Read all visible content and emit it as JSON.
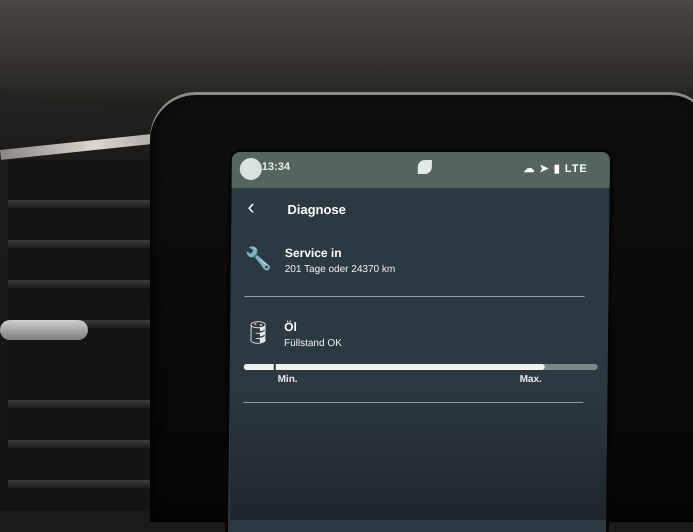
{
  "status_bar": {
    "time": "13:34",
    "indicators": "LTE",
    "icons": [
      "profile-icon",
      "leaf-icon",
      "cloud-icon",
      "location-icon",
      "signal-icon"
    ]
  },
  "header": {
    "back_icon": "chevron-left-icon",
    "title": "Diagnose"
  },
  "service": {
    "icon": "wrench-icon",
    "title": "Service in",
    "detail": "201 Tage oder 24370 km"
  },
  "oil": {
    "icon": "oil-can-icon",
    "title": "Öl",
    "detail": "Füllstand OK",
    "level_fraction": 0.85,
    "min_label": "Min.",
    "max_label": "Max."
  },
  "colors": {
    "status_bar": "#55645c",
    "screen_bg": "#2d3940",
    "level_fill": "#eff4ef"
  }
}
